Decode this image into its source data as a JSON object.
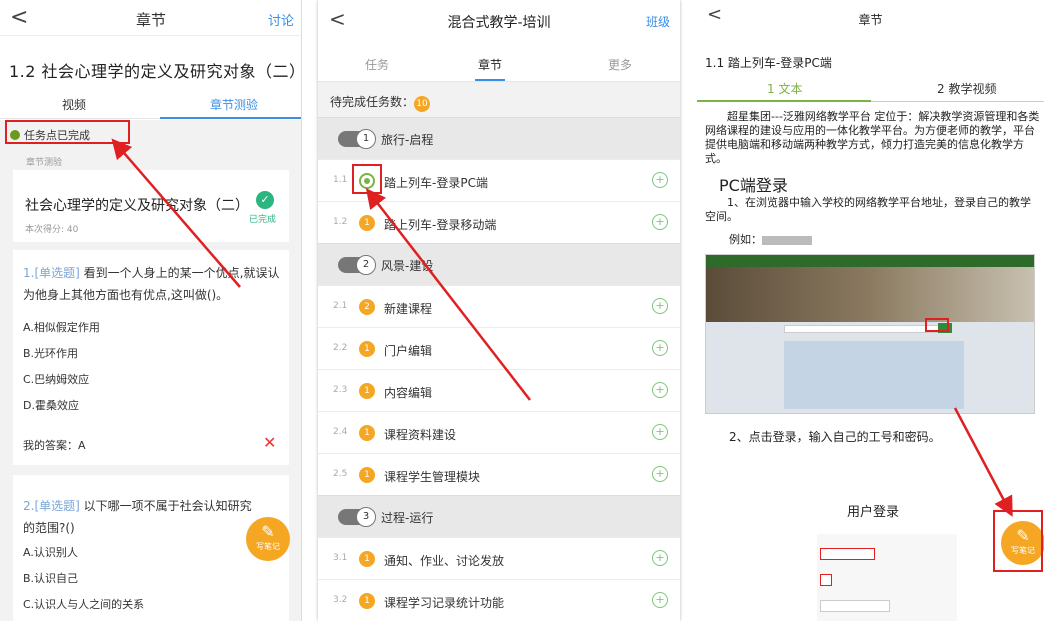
{
  "panel1": {
    "back": "<",
    "title": "章节",
    "discuss": "讨论",
    "heading": "1.2 社会心理学的定义及研究对象（二）",
    "tabs": [
      "视频",
      "章节测验"
    ],
    "status": "任务点已完成",
    "section_label": "章节测验",
    "quiz_title": "社会心理学的定义及研究对象（二）",
    "score": "本次得分: 40",
    "done": "已完成",
    "q1": {
      "type": "1.[单选题]",
      "text": "看到一个人身上的某一个优点,就误认为他身上其他方面也有优点,这叫做()。",
      "options": [
        "A.相似假定作用",
        "B.光环作用",
        "C.巴纳姆效应",
        "D.霍桑效应"
      ],
      "my_answer": "我的答案：A",
      "wrong": "✕"
    },
    "q2": {
      "type": "2.[单选题]",
      "text": "以下哪一项不属于社会认知研究的范围?()",
      "options": [
        "A.认识别人",
        "B.认识自己",
        "C.认识人与人之间的关系"
      ]
    },
    "note_fab": "写笔记",
    "note_icon": "✎"
  },
  "panel2": {
    "back": "<",
    "title": "混合式教学-培训",
    "class_link": "班级",
    "tabs": [
      "任务",
      "章节",
      "更多"
    ],
    "pending_label": "待完成任务数：",
    "pending_count": "10",
    "sections": [
      {
        "num": "1",
        "title": "旅行-启程"
      },
      {
        "num": "2",
        "title": "风景-建设"
      },
      {
        "num": "3",
        "title": "过程-运行"
      }
    ],
    "tasks": [
      {
        "num": "1.1",
        "badge": "",
        "title": "踏上列车-登录PC端"
      },
      {
        "num": "1.2",
        "badge": "1",
        "title": "踏上列车-登录移动端"
      },
      {
        "num": "2.1",
        "badge": "2",
        "title": "新建课程"
      },
      {
        "num": "2.2",
        "badge": "1",
        "title": "门户编辑"
      },
      {
        "num": "2.3",
        "badge": "1",
        "title": "内容编辑"
      },
      {
        "num": "2.4",
        "badge": "1",
        "title": "课程资料建设"
      },
      {
        "num": "2.5",
        "badge": "1",
        "title": "课程学生管理模块"
      },
      {
        "num": "3.1",
        "badge": "1",
        "title": "通知、作业、讨论发放"
      },
      {
        "num": "3.2",
        "badge": "1",
        "title": "课程学习记录统计功能"
      }
    ],
    "plus": "+"
  },
  "panel3": {
    "back": "<",
    "title": "章节",
    "heading": "1.1 踏上列车-登录PC端",
    "tabs": [
      "1 文本",
      "2 教学视频"
    ],
    "para1": "超星集团---泛雅网络教学平台  定位于：解决教学资源管理和各类网络课程的建设与应用的一体化教学平台。为方便老师的教学，平台提供电脑端和移动端两种教学方式，倾力打造完美的信息化教学方式。",
    "h2": "PC端登录",
    "para2": "1、在浏览器中输入学校的网络教学平台地址，登录自己的教学空间。",
    "example": "例如：",
    "step2": "2、点击登录，输入自己的工号和密码。",
    "login_title": "用户登录",
    "note_fab": "写笔记",
    "note_icon": "✎"
  }
}
